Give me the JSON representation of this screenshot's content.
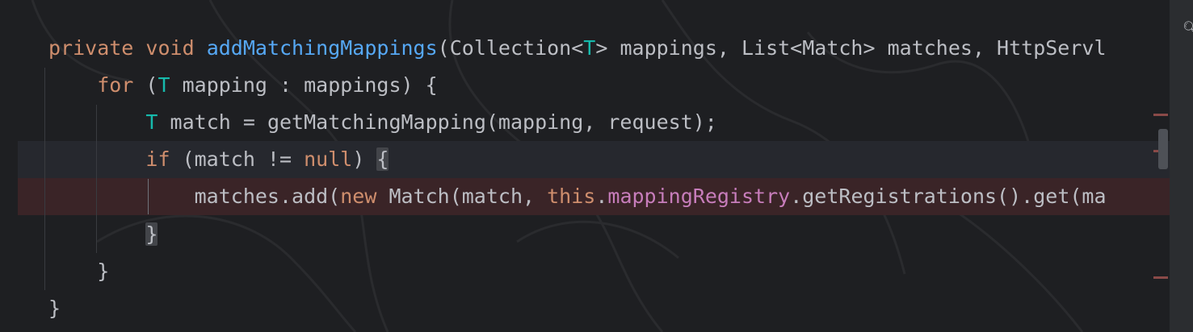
{
  "editor": {
    "lines": [
      {
        "tokens": [
          {
            "t": "private ",
            "c": "kw"
          },
          {
            "t": "void ",
            "c": "kw"
          },
          {
            "t": "addMatchingMappings",
            "c": "fn"
          },
          {
            "t": "(Collection<",
            "c": ""
          },
          {
            "t": "T",
            "c": "tp"
          },
          {
            "t": "> mappings, List<Match> matches, HttpServl",
            "c": ""
          }
        ]
      },
      {
        "tokens": [
          {
            "t": "    for ",
            "c": "kw"
          },
          {
            "t": "(",
            "c": ""
          },
          {
            "t": "T",
            "c": "tp"
          },
          {
            "t": " mapping : mappings) {",
            "c": ""
          }
        ]
      },
      {
        "tokens": [
          {
            "t": "        ",
            "c": ""
          },
          {
            "t": "T",
            "c": "tp"
          },
          {
            "t": " match = getMatchingMapping(mapping, request);",
            "c": ""
          }
        ]
      },
      {
        "tokens": [
          {
            "t": "        if ",
            "c": "kw"
          },
          {
            "t": "(match != ",
            "c": ""
          },
          {
            "t": "null",
            "c": "kw"
          },
          {
            "t": ") ",
            "c": ""
          },
          {
            "t": "{",
            "c": "brace-match"
          }
        ]
      },
      {
        "tokens": [
          {
            "t": "            matches.add(",
            "c": ""
          },
          {
            "t": "new ",
            "c": "kw"
          },
          {
            "t": "Match(match, ",
            "c": ""
          },
          {
            "t": "this",
            "c": "kw"
          },
          {
            "t": ".",
            "c": ""
          },
          {
            "t": "mappingRegistry",
            "c": "fld"
          },
          {
            "t": ".getRegistrations().get(ma",
            "c": ""
          }
        ]
      },
      {
        "tokens": [
          {
            "t": "        ",
            "c": ""
          },
          {
            "t": "}",
            "c": "brace-match"
          }
        ]
      },
      {
        "tokens": [
          {
            "t": "    }",
            "c": ""
          }
        ]
      },
      {
        "tokens": [
          {
            "t": "}",
            "c": ""
          }
        ]
      }
    ],
    "caret_line": 4,
    "highlighted_line": 5
  },
  "colors": {
    "background": "#1e1f22",
    "keyword": "#cf8e6d",
    "type_param": "#16baac",
    "method_decl": "#56a8f5",
    "field": "#c77dbb",
    "text": "#bcbec4",
    "breakpoint_line": "#3a2427"
  },
  "icons": {
    "hint": "magnifier-hint-icon"
  }
}
